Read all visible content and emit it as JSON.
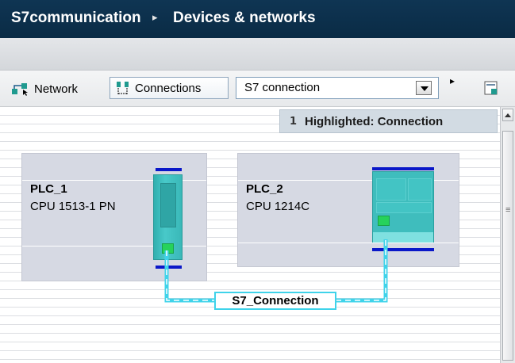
{
  "breadcrumb": {
    "project": "S7communication",
    "separator": "▸",
    "page": "Devices & networks"
  },
  "toolbar": {
    "network_label": "Network",
    "connections_label": "Connections",
    "connection_type_value": "S7 connection",
    "more_glyph": "▸"
  },
  "highlight": {
    "label": "Highlighted: Connection"
  },
  "devices": [
    {
      "name": "PLC_1",
      "cpu": "CPU 1513-1 PN"
    },
    {
      "name": "PLC_2",
      "cpu": "CPU 1214C"
    }
  ],
  "connection": {
    "name": "S7_Connection"
  },
  "colors": {
    "titlebar": "#0f3553",
    "device_box": "#d6d9e3",
    "cpu_module": "#3fbdbd",
    "profinet_port": "#26d25b",
    "bus_line": "#0a17c8",
    "connection_line": "#3fd3ea"
  }
}
